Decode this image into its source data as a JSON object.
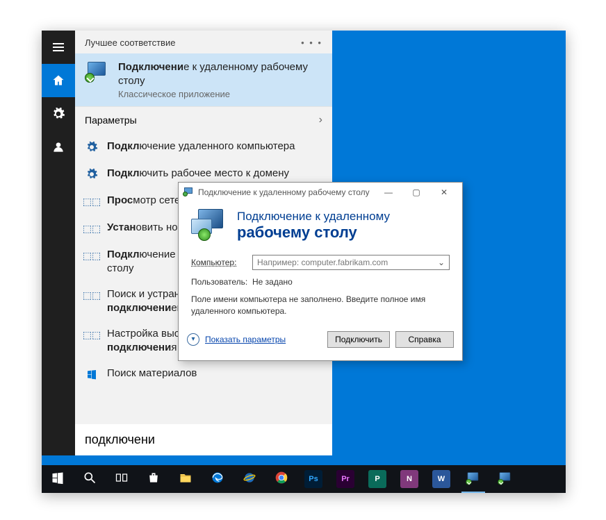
{
  "colors": {
    "accent": "#0078d7"
  },
  "start": {
    "header": "Лучшее соответствие",
    "best": {
      "title_bold": "Подключени",
      "title_rest": "е к удаленному рабочему столу",
      "subtitle": "Классическое приложение"
    },
    "section_params": "Параметры",
    "items": [
      {
        "icon": "gear",
        "pre": "",
        "bold": "Подкл",
        "rest": "ючение удаленного компьютера"
      },
      {
        "icon": "gear",
        "pre": "",
        "bold": "Подкл",
        "rest": "ючить рабочее место к домену"
      },
      {
        "icon": "network",
        "pre": "",
        "bold": "Прос",
        "rest": "мотр сетевых подключений"
      },
      {
        "icon": "network",
        "pre": "",
        "bold": "Устан",
        "rest": "овить новое подключение"
      },
      {
        "icon": "network",
        "pre": "",
        "bold": "Подкл",
        "rest": "ючение к удаленному рабочему столу"
      },
      {
        "icon": "network",
        "pre": "Поиск и устранение проблем с сетью и ",
        "bold": "подключени",
        "rest": "ем"
      },
      {
        "icon": "network",
        "pre": "Настройка высокоскоростного ",
        "bold": "подключени",
        "rest": "я"
      },
      {
        "icon": "windows",
        "pre": "Поиск материалов",
        "bold": "",
        "rest": ""
      }
    ],
    "search_value": "подключени"
  },
  "rdp": {
    "title": "Подключение к удаленному рабочему столу",
    "hero_line1": "Подключение к удаленному",
    "hero_line2": "рабочему столу",
    "computer_label": "Компьютер:",
    "computer_placeholder": "Например: computer.fabrikam.com",
    "user_label": "Пользователь:",
    "user_value": "Не задано",
    "hint": "Поле имени компьютера не заполнено. Введите полное имя удаленного компьютера.",
    "show_options": "Показать параметры",
    "connect": "Подключить",
    "help": "Справка"
  },
  "taskbar": [
    {
      "name": "start",
      "type": "start"
    },
    {
      "name": "search",
      "type": "search"
    },
    {
      "name": "taskview",
      "type": "taskview"
    },
    {
      "name": "store",
      "type": "store"
    },
    {
      "name": "explorer",
      "type": "explorer"
    },
    {
      "name": "edge",
      "type": "edge"
    },
    {
      "name": "ie",
      "type": "ie"
    },
    {
      "name": "chrome",
      "type": "chrome"
    },
    {
      "name": "photoshop",
      "type": "badge",
      "bg": "#001d36",
      "fg": "#31a8ff",
      "label": "Ps"
    },
    {
      "name": "premiere",
      "type": "badge",
      "bg": "#2a0033",
      "fg": "#ea77ff",
      "label": "Pr"
    },
    {
      "name": "publisher",
      "type": "badge",
      "bg": "#0a6b5a",
      "fg": "#ffffff",
      "label": "P"
    },
    {
      "name": "onenote",
      "type": "badge",
      "bg": "#80397b",
      "fg": "#ffffff",
      "label": "N"
    },
    {
      "name": "word",
      "type": "badge",
      "bg": "#2b579a",
      "fg": "#ffffff",
      "label": "W"
    },
    {
      "name": "rdp1",
      "type": "rdp",
      "running": true
    },
    {
      "name": "rdp2",
      "type": "rdp",
      "running": false
    }
  ]
}
